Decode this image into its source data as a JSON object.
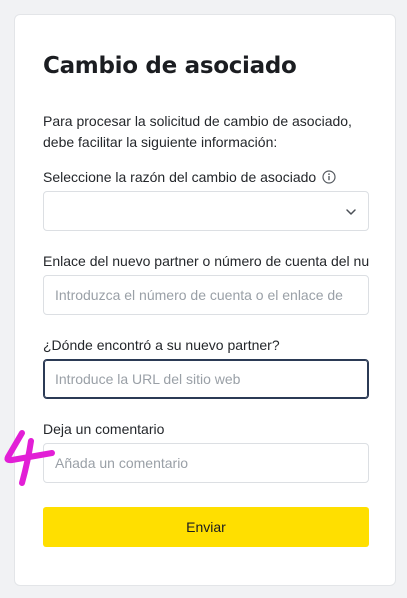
{
  "form": {
    "title": "Cambio de asociado",
    "intro": "Para procesar la solicitud de cambio de asociado, debe facilitar la siguiente información:",
    "reason": {
      "label": "Seleccione la razón del cambio de asociado",
      "value": "",
      "icon": "info-icon"
    },
    "partner_link": {
      "label": "Enlace del nuevo partner o número de cuenta del nuevo partner",
      "placeholder": "Introduzca el número de cuenta o el enlace de"
    },
    "where_found": {
      "label": "¿Dónde encontró a su nuevo partner?",
      "placeholder": "Introduce la URL del sitio web"
    },
    "comment": {
      "label": "Deja un comentario",
      "placeholder": "Añada un comentario"
    },
    "submit_label": "Enviar"
  },
  "annotation": {
    "handwritten_mark": "4",
    "color": "#e21fd6"
  },
  "colors": {
    "accent": "#ffdf00",
    "focus_border": "#2b3a55"
  }
}
